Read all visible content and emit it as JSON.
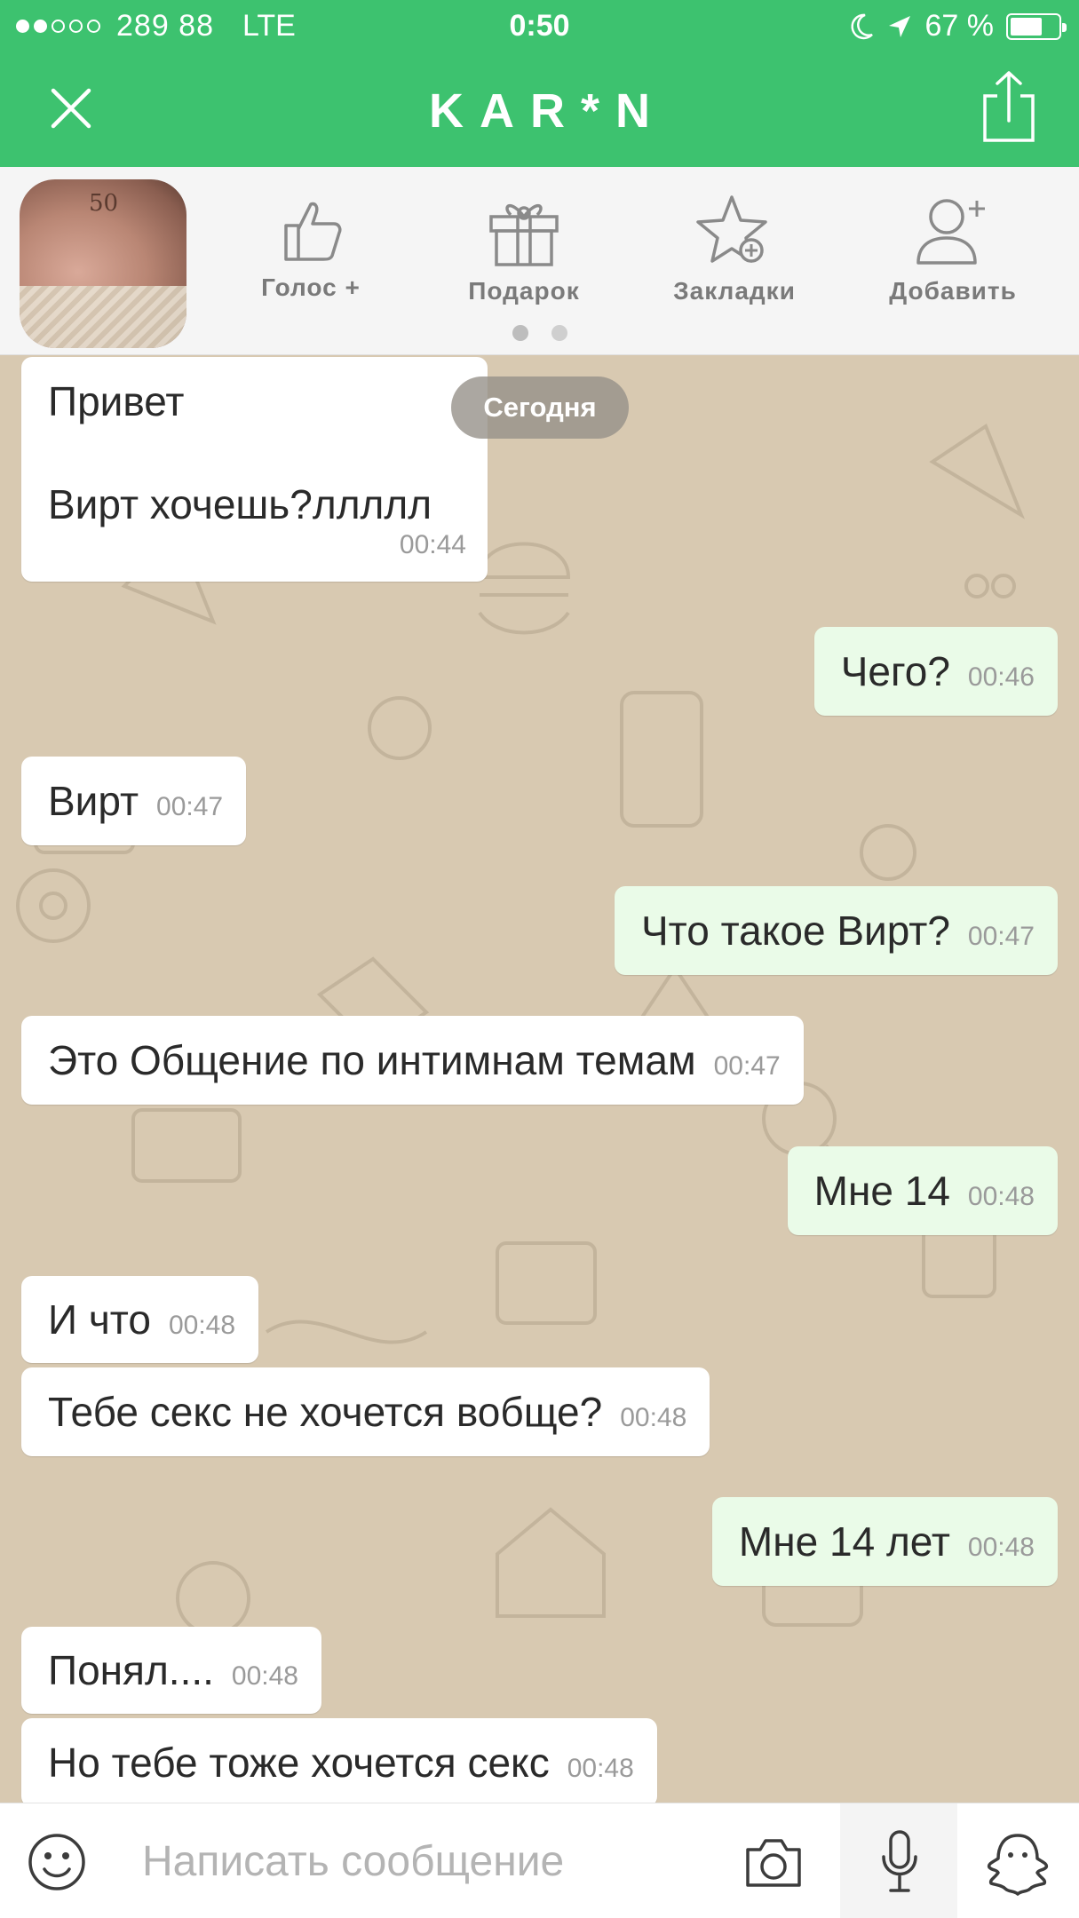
{
  "status_bar": {
    "carrier": "289 88",
    "network": "LTE",
    "time": "0:50",
    "battery_text": "67 %",
    "battery_level": 0.67,
    "signal_bars_filled": 2,
    "signal_bars_total": 5
  },
  "header": {
    "title": "KAR*N",
    "close_icon": "close-icon",
    "share_icon": "share-icon",
    "background_color": "#3dc26f"
  },
  "profile": {
    "avatar_text": "50",
    "actions": [
      {
        "label": "Голос +",
        "icon": "thumbs-up-icon"
      },
      {
        "label": "Подарок",
        "icon": "gift-icon"
      },
      {
        "label": "Закладки",
        "icon": "star-add-icon"
      },
      {
        "label": "Добавить",
        "icon": "add-user-icon"
      }
    ],
    "pager_pages": 2,
    "pager_current": 1
  },
  "chat": {
    "date_label": "Сегодня",
    "messages": [
      {
        "side": "in",
        "lines": [
          "Привет",
          "",
          "Вирт хочешь?ллллл"
        ],
        "time": "00:44"
      },
      {
        "side": "out",
        "text": "Чего?",
        "time": "00:46"
      },
      {
        "side": "in",
        "text": "Вирт",
        "time": "00:47"
      },
      {
        "side": "out",
        "text": "Что такое Вирт?",
        "time": "00:47"
      },
      {
        "side": "in",
        "text": "Это Общение по интимнам темам",
        "time": "00:47"
      },
      {
        "side": "out",
        "text": "Мне 14",
        "time": "00:48"
      },
      {
        "side": "in",
        "text": "И что",
        "time": "00:48"
      },
      {
        "side": "in",
        "text": "Тебе секс не хочется вобще?",
        "time": "00:48"
      },
      {
        "side": "out",
        "text": "Мне 14 лет",
        "time": "00:48"
      },
      {
        "side": "in",
        "text": "Понял....",
        "time": "00:48"
      },
      {
        "side": "in",
        "text": "Но тебе тоже хочется секс",
        "time": "00:48"
      }
    ],
    "incoming_color": "#ffffff",
    "outgoing_color": "#eafbe8",
    "wallpaper_color": "#d8c9b1"
  },
  "input_bar": {
    "placeholder": "Написать сообщение",
    "value": "",
    "icons": [
      "smile-icon",
      "camera-icon",
      "microphone-icon",
      "ghost-icon"
    ]
  }
}
